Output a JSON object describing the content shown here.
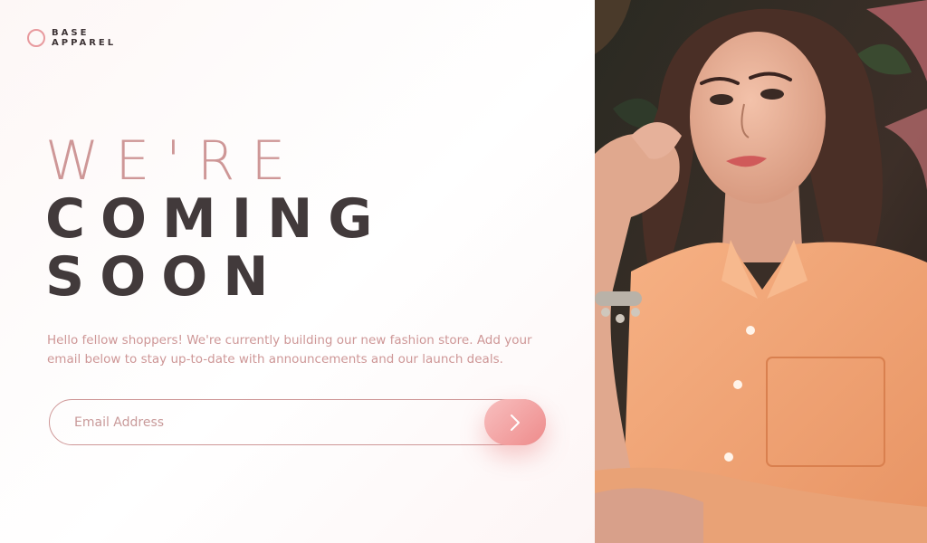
{
  "logo": {
    "line1": "BASE",
    "line2": "APPAREL"
  },
  "headline": {
    "line1": "WE'RE",
    "line2": "COMING",
    "line3": "SOON"
  },
  "description": "Hello fellow shoppers! We're currently building our new fashion store. Add your email below to stay up-to-date with announcements and our launch deals.",
  "form": {
    "email_placeholder": "Email Address",
    "submit_icon": "chevron-right-icon"
  },
  "hero_image": {
    "icon": "woman-photo"
  },
  "colors": {
    "accent": "#ce9797",
    "dark": "#423a3b",
    "button_start": "#f8bfbf",
    "button_end": "#ee8b8b",
    "shirt": "#f0a777"
  }
}
